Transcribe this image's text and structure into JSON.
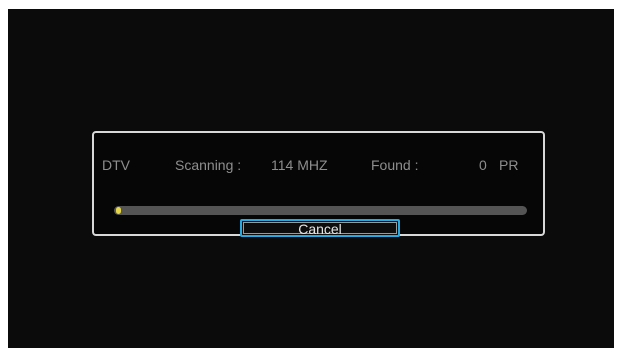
{
  "scan_dialog": {
    "type_label": "DTV",
    "scanning_label": "Scanning :",
    "frequency": "114 MHZ",
    "found_label": "Found :",
    "found_count": "0",
    "found_unit": "PR",
    "progress_fraction": 0.012,
    "cancel_label": "Cancel"
  },
  "colors": {
    "screen_background": "#0b0b0b",
    "dialog_border": "#d8d8d8",
    "text_dim": "#8e8e8e",
    "progress_track": "#545454",
    "progress_fill": "#e6d64a",
    "focus_border": "#2aa8e0"
  }
}
